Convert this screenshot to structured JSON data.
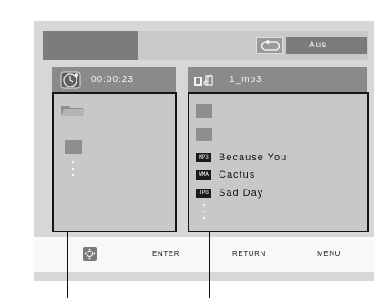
{
  "top_bar": {
    "repeat_icon": "repeat-icon",
    "repeat_value": "Aus"
  },
  "left_pane": {
    "header_icon": "clock-disc-icon",
    "time": "00:00:23"
  },
  "right_pane": {
    "header_icon": "music-folder-icon",
    "folder_name": "1_mp3",
    "files": [
      {
        "type": "MP3",
        "name": "Because You"
      },
      {
        "type": "WMA",
        "name": "Cactus"
      },
      {
        "type": "JPG",
        "name": "Sad Day"
      }
    ]
  },
  "footer": {
    "nav_icon": "navigation-pad-icon",
    "enter": "ENTER",
    "return": "RETURN",
    "menu": "MENU"
  },
  "colors": {
    "panel": "#d7d7d7",
    "header": "#8a8a8a",
    "outline": "#151515"
  }
}
